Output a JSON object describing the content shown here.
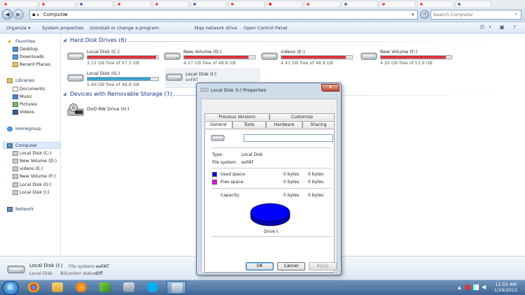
{
  "explorer": {
    "breadcrumb": [
      "Computer"
    ],
    "search_placeholder": "Search Computer",
    "toolbar": [
      "Organize ▾",
      "System properties",
      "Uninstall or change a program",
      "Map network drive",
      "Open Control Panel"
    ],
    "nav": {
      "favorites_header": "Favorites",
      "favorites": [
        "Desktop",
        "Downloads",
        "Recent Places"
      ],
      "libraries_header": "Libraries",
      "libraries": [
        "Documents",
        "Music",
        "Pictures",
        "Videos"
      ],
      "homegroup": "Homegroup",
      "computer_header": "Computer",
      "computer_items": [
        "Local Disk (C:)",
        "New Volume (D:)",
        "videos (E:)",
        "New Volume (F:)",
        "Local Disk (G:)",
        "Local Disk (I:)"
      ],
      "network": "Network"
    },
    "groups": {
      "hard_disks": "Hard Disk Drives (6)",
      "removable": "Devices with Removable Storage (1)"
    },
    "drives": [
      {
        "name": "Local Disk (C:)",
        "free": "3.12 GB free of 97.5 GB",
        "used_fraction": 0.97,
        "bar_color": "#d9232c"
      },
      {
        "name": "New Volume (D:)",
        "free": "4.27 GB free of 48.8 GB",
        "used_fraction": 0.91,
        "bar_color": "#d9232c"
      },
      {
        "name": "videos (E:)",
        "free": "4.41 GB free of 48.8 GB",
        "used_fraction": 0.91,
        "bar_color": "#d9232c"
      },
      {
        "name": "New Volume (F:)",
        "free": "4.26 GB free of 53.9 GB",
        "used_fraction": 0.92,
        "bar_color": "#d9232c"
      },
      {
        "name": "Local Disk (G:)",
        "free": "5.46 GB free of 48.8 GB",
        "used_fraction": 0.89,
        "bar_color": "#2b9bcc"
      },
      {
        "name": "Local Disk (I:)",
        "free": "exFAT",
        "used_fraction": null,
        "bar_color": ""
      }
    ],
    "removable": [
      {
        "name": "DVD RW Drive (H:)"
      }
    ],
    "details": {
      "title": "Local Disk (I:)",
      "subtitle": "Local Disk",
      "fs_label": "File system:",
      "fs_value": "exFAT",
      "bitlocker_label": "BitLocker status:",
      "bitlocker_value": "Off"
    }
  },
  "dialog": {
    "title": "Local Disk (I:) Properties",
    "tabs_row1": [
      "Previous Versions",
      "Customize"
    ],
    "tabs_row2": [
      "General",
      "Tools",
      "Hardware",
      "Sharing"
    ],
    "name_value": "",
    "type_label": "Type:",
    "type_value": "Local Disk",
    "fs_label": "File system:",
    "fs_value": "exFAT",
    "used_label": "Used space:",
    "used_bytes": "0 bytes",
    "used_size": "0 bytes",
    "free_label": "Free space:",
    "free_bytes": "0 bytes",
    "free_size": "0 bytes",
    "capacity_label": "Capacity:",
    "capacity_bytes": "0 bytes",
    "capacity_size": "0 bytes",
    "drive_caption": "Drive I:",
    "ok": "OK",
    "cancel": "Cancel",
    "apply": "Apply",
    "used_color": "#0000ff",
    "free_color": "#ff00ff"
  },
  "taskbar": {
    "time": "11:50 AM",
    "date": "1/16/2012"
  }
}
